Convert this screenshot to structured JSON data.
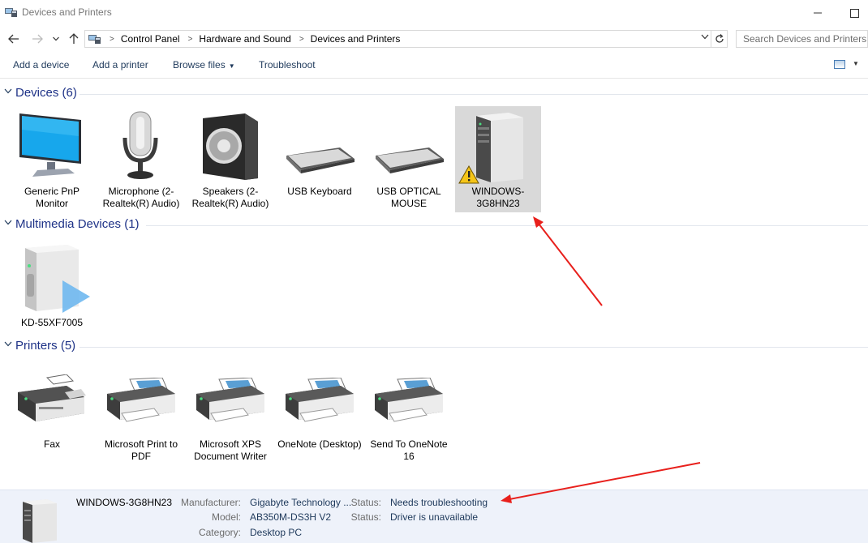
{
  "window": {
    "title": "Devices and Printers"
  },
  "nav": {
    "breadcrumbs": [
      "Control Panel",
      "Hardware and Sound",
      "Devices and Printers"
    ],
    "search_placeholder": "Search Devices and Printers"
  },
  "commands": {
    "add_device": "Add a device",
    "add_printer": "Add a printer",
    "browse_files": "Browse files",
    "troubleshoot": "Troubleshoot"
  },
  "groups": {
    "devices": {
      "title": "Devices (6)",
      "items": [
        {
          "label": "Generic PnP Monitor",
          "icon": "monitor-icon"
        },
        {
          "label": "Microphone (2- Realtek(R) Audio)",
          "icon": "microphone-icon"
        },
        {
          "label": "Speakers (2- Realtek(R) Audio)",
          "icon": "speaker-icon"
        },
        {
          "label": "USB Keyboard",
          "icon": "keyboard-icon"
        },
        {
          "label": "USB OPTICAL MOUSE",
          "icon": "keyboard-icon"
        },
        {
          "label": "WINDOWS-3G8HN23",
          "icon": "computer-warning-icon",
          "selected": true,
          "warning": true
        }
      ]
    },
    "multimedia": {
      "title": "Multimedia Devices (1)",
      "items": [
        {
          "label": "KD-55XF7005",
          "icon": "media-device-icon"
        }
      ]
    },
    "printers": {
      "title": "Printers (5)",
      "items": [
        {
          "label": "Fax",
          "icon": "fax-icon"
        },
        {
          "label": "Microsoft Print to PDF",
          "icon": "printer-icon"
        },
        {
          "label": "Microsoft XPS Document Writer",
          "icon": "printer-icon"
        },
        {
          "label": "OneNote (Desktop)",
          "icon": "printer-icon"
        },
        {
          "label": "Send To OneNote 16",
          "icon": "printer-icon"
        }
      ]
    }
  },
  "details": {
    "name": "WINDOWS-3G8HN23",
    "manufacturer_label": "Manufacturer:",
    "manufacturer": "Gigabyte Technology ...",
    "model_label": "Model:",
    "model": "AB350M-DS3H V2",
    "category_label": "Category:",
    "category": "Desktop PC",
    "status1_label": "Status:",
    "status1": "Needs troubleshooting",
    "status2_label": "Status:",
    "status2": "Driver is unavailable"
  },
  "colors": {
    "link_text": "#1e395b",
    "group_title": "#1e3287",
    "details_bg": "#eef2fa",
    "annotation_arrow": "#e8201c",
    "selection": "#d9d9d9"
  }
}
